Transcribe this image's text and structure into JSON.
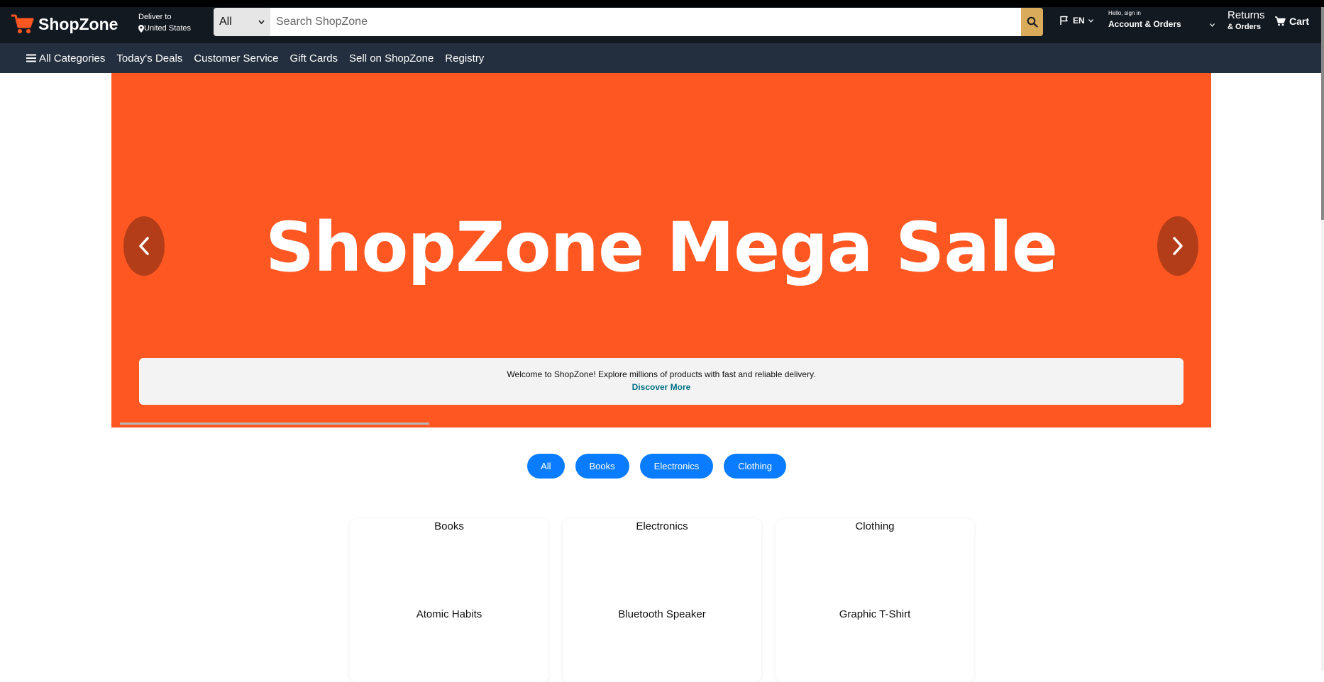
{
  "header": {
    "logo_text": "ShopZone",
    "deliver_label": "Deliver to",
    "deliver_location": "United States",
    "search_category": "All",
    "search_placeholder": "Search ShopZone",
    "language": "EN",
    "account_greeting": "Hello, sign in",
    "account_label": "Account & Orders",
    "returns_label": "Returns",
    "orders_label": "& Orders",
    "cart_label": "Cart"
  },
  "nav": {
    "items": [
      {
        "label": "All Categories"
      },
      {
        "label": "Today's Deals"
      },
      {
        "label": "Customer Service"
      },
      {
        "label": "Gift Cards"
      },
      {
        "label": "Sell on ShopZone"
      },
      {
        "label": "Registry"
      }
    ]
  },
  "hero": {
    "title": "ShopZone Mega Sale",
    "background": "#ff5722",
    "info_text": "Welcome to ShopZone! Explore millions of products with fast and reliable delivery.",
    "info_link": "Discover More"
  },
  "filters": [
    "All",
    "Books",
    "Electronics",
    "Clothing"
  ],
  "cards": [
    {
      "category": "Books",
      "product": "Atomic Habits"
    },
    {
      "category": "Electronics",
      "product": "Bluetooth Speaker"
    },
    {
      "category": "Clothing",
      "product": "Graphic T-Shirt"
    }
  ],
  "colors": {
    "header_bg": "#131921",
    "nav_bg": "#232f3e",
    "accent": "#ff5722",
    "pill": "#0a7cff",
    "link": "#007185"
  }
}
